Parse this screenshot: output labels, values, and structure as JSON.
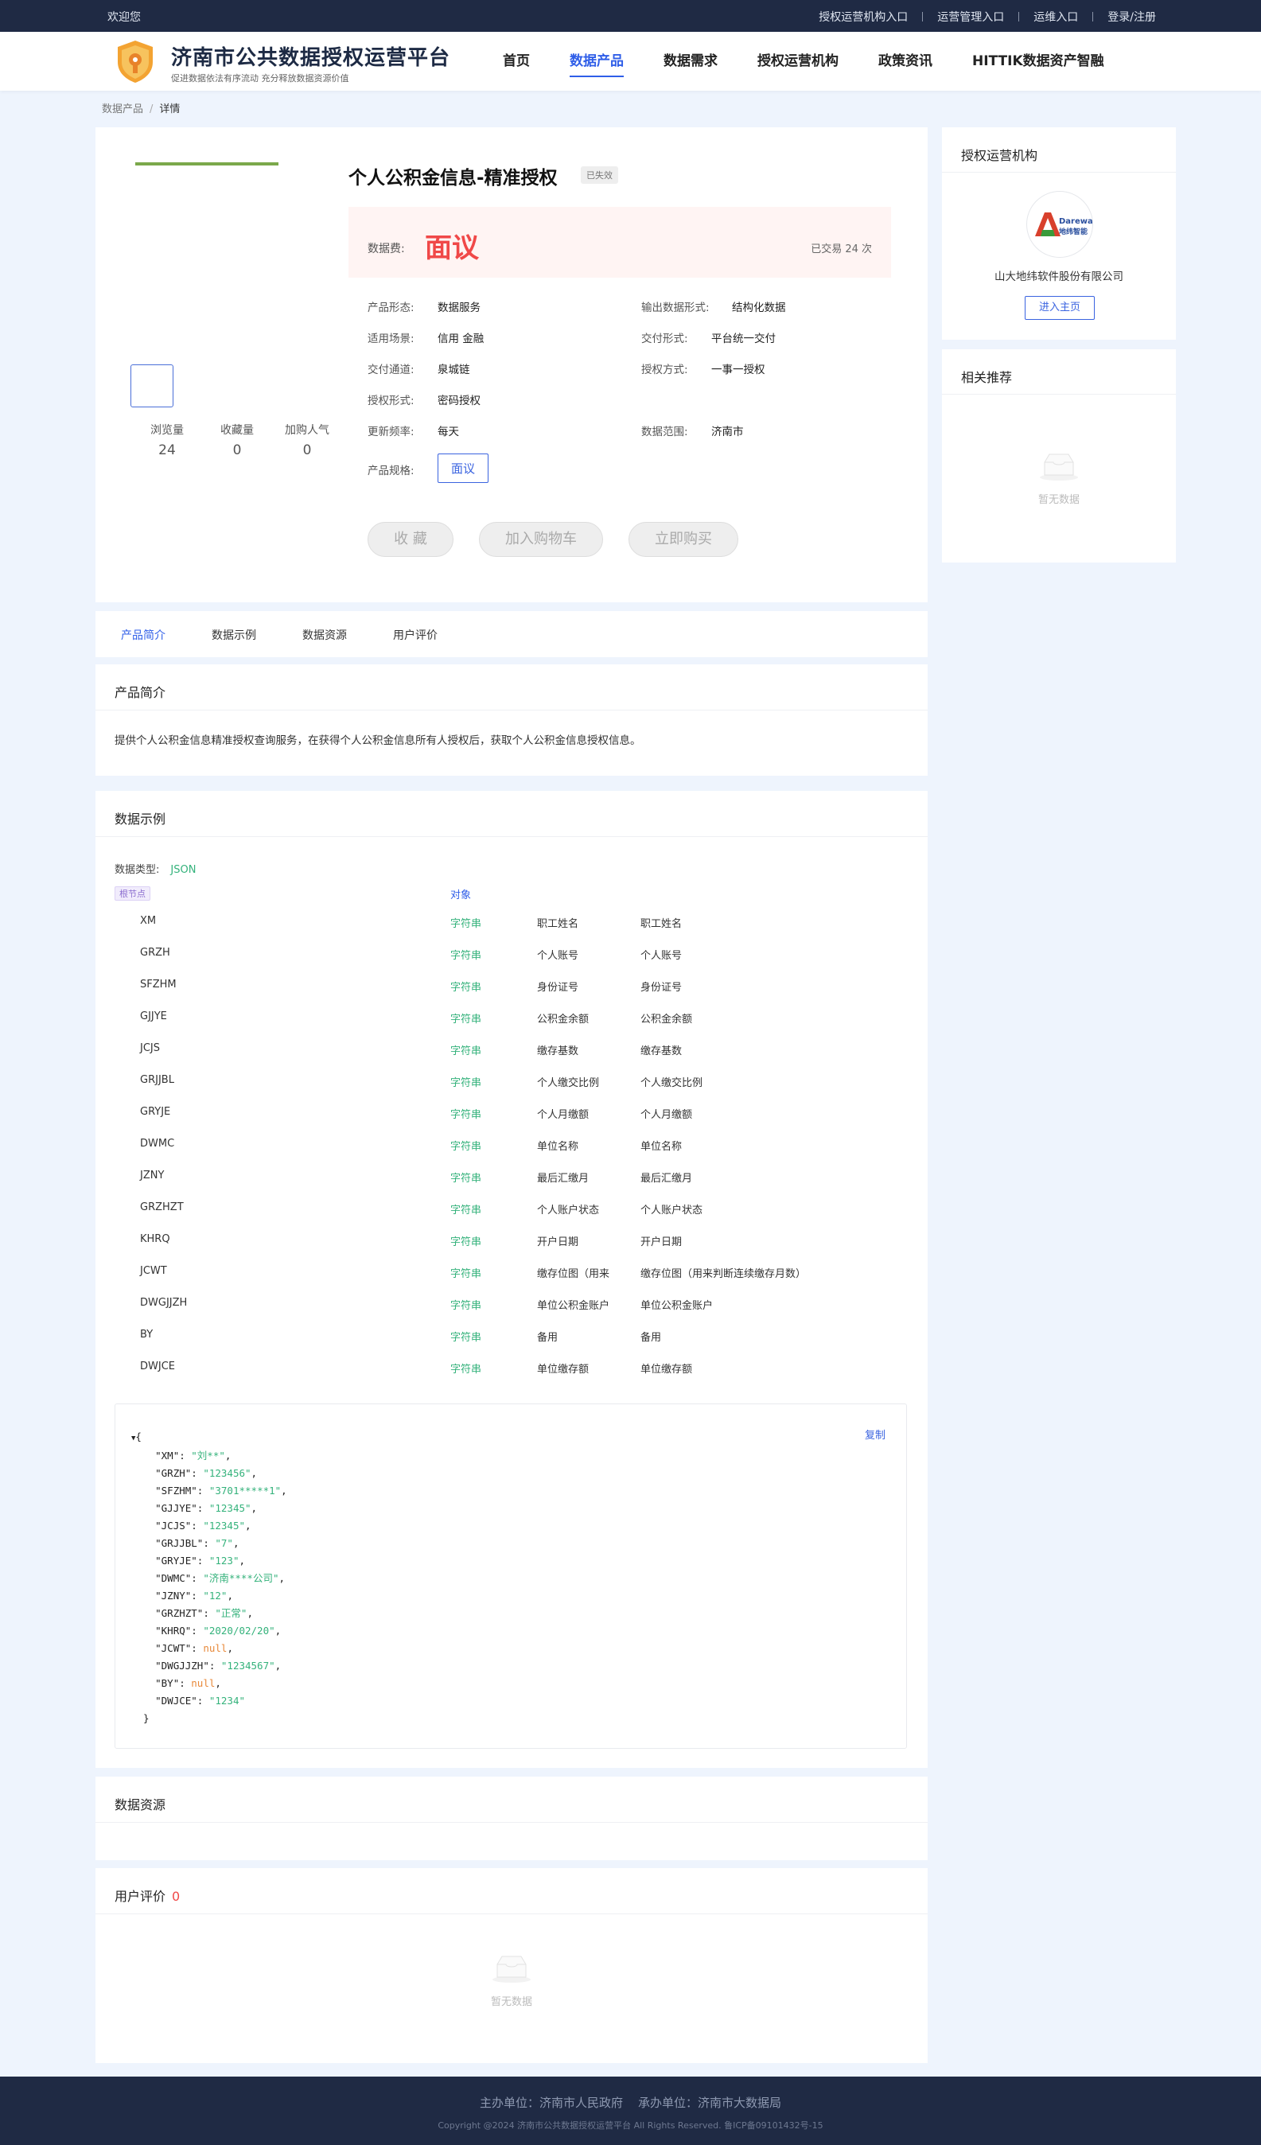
{
  "topbar": {
    "welcome": "欢迎您",
    "links": [
      "授权运营机构入口",
      "运营管理入口",
      "运维入口",
      "登录/注册"
    ]
  },
  "header": {
    "title": "济南市公共数据授权运营平台",
    "subtitle": "促进数据依法有序流动 充分释放数据资源价值",
    "nav": [
      "首页",
      "数据产品",
      "数据需求",
      "授权运营机构",
      "政策资讯",
      "HITTIK数据资产智融"
    ],
    "active_nav": "数据产品"
  },
  "breadcrumb": {
    "parent": "数据产品",
    "current": "详情"
  },
  "product": {
    "title": "个人公积金信息-精准授权",
    "status_badge": "已失效",
    "price_label": "数据费:",
    "price": "面议",
    "trade_count": "已交易 24 次",
    "stats": [
      {
        "label": "浏览量",
        "value": "24"
      },
      {
        "label": "收藏量",
        "value": "0"
      },
      {
        "label": "加购人气",
        "value": "0"
      }
    ],
    "attrs": {
      "form_label": "产品形态:",
      "form": "数据服务",
      "output_label": "输出数据形式:",
      "output": "结构化数据",
      "scene_label": "适用场景:",
      "scene": "信用  金融",
      "delivery_label": "交付形式:",
      "delivery": "平台统一交付",
      "channel_label": "交付通道:",
      "channel": "泉城链",
      "auth_mode_label": "授权方式:",
      "auth_mode": "一事一授权",
      "auth_form_label": "授权形式:",
      "auth_form": "密码授权",
      "freq_label": "更新频率:",
      "freq": "每天",
      "range_label": "数据范围:",
      "range": "济南市",
      "spec_label": "产品规格:",
      "spec": "面议"
    },
    "actions": [
      "收 藏",
      "加入购物车",
      "立即购买"
    ]
  },
  "tabs": [
    "产品简介",
    "数据示例",
    "数据资源",
    "用户评价"
  ],
  "intro": {
    "title": "产品简介",
    "text": "提供个人公积金信息精准授权查询服务，在获得个人公积金信息所有人授权后，获取个人公积金信息授权信息。"
  },
  "sample": {
    "title": "数据示例",
    "type_label": "数据类型:",
    "type_value": "JSON",
    "root_tag": "根节点",
    "root_type": "对象",
    "fields": [
      {
        "name": "XM",
        "type": "字符串",
        "d1": "职工姓名",
        "d2": "职工姓名"
      },
      {
        "name": "GRZH",
        "type": "字符串",
        "d1": "个人账号",
        "d2": "个人账号"
      },
      {
        "name": "SFZHM",
        "type": "字符串",
        "d1": "身份证号",
        "d2": "身份证号"
      },
      {
        "name": "GJJYE",
        "type": "字符串",
        "d1": "公积金余额",
        "d2": "公积金余额"
      },
      {
        "name": "JCJS",
        "type": "字符串",
        "d1": "缴存基数",
        "d2": "缴存基数"
      },
      {
        "name": "GRJJBL",
        "type": "字符串",
        "d1": "个人缴交比例",
        "d2": "个人缴交比例"
      },
      {
        "name": "GRYJE",
        "type": "字符串",
        "d1": "个人月缴额",
        "d2": "个人月缴额"
      },
      {
        "name": "DWMC",
        "type": "字符串",
        "d1": "单位名称",
        "d2": "单位名称"
      },
      {
        "name": "JZNY",
        "type": "字符串",
        "d1": "最后汇缴月",
        "d2": "最后汇缴月"
      },
      {
        "name": "GRZHZT",
        "type": "字符串",
        "d1": "个人账户状态",
        "d2": "个人账户状态"
      },
      {
        "name": "KHRQ",
        "type": "字符串",
        "d1": "开户日期",
        "d2": "开户日期"
      },
      {
        "name": "JCWT",
        "type": "字符串",
        "d1": "缴存位图（用来",
        "d2": "缴存位图（用来判断连续缴存月数）"
      },
      {
        "name": "DWGJJZH",
        "type": "字符串",
        "d1": "单位公积金账户",
        "d2": "单位公积金账户"
      },
      {
        "name": "BY",
        "type": "字符串",
        "d1": "备用",
        "d2": "备用"
      },
      {
        "name": "DWJCE",
        "type": "字符串",
        "d1": "单位缴存额",
        "d2": "单位缴存额"
      }
    ],
    "copy_label": "复制",
    "json_lines": [
      {
        "k": "XM",
        "v": "\"刘**\"",
        "t": "s"
      },
      {
        "k": "GRZH",
        "v": "\"123456\"",
        "t": "s"
      },
      {
        "k": "SFZHM",
        "v": "\"3701*****1\"",
        "t": "s"
      },
      {
        "k": "GJJYE",
        "v": "\"12345\"",
        "t": "s"
      },
      {
        "k": "JCJS",
        "v": "\"12345\"",
        "t": "s"
      },
      {
        "k": "GRJJBL",
        "v": "\"7\"",
        "t": "s"
      },
      {
        "k": "GRYJE",
        "v": "\"123\"",
        "t": "s"
      },
      {
        "k": "DWMC",
        "v": "\"济南****公司\"",
        "t": "s"
      },
      {
        "k": "JZNY",
        "v": "\"12\"",
        "t": "s"
      },
      {
        "k": "GRZHZT",
        "v": "\"正常\"",
        "t": "s"
      },
      {
        "k": "KHRQ",
        "v": "\"2020/02/20\"",
        "t": "s"
      },
      {
        "k": "JCWT",
        "v": "null",
        "t": "n"
      },
      {
        "k": "DWGJJZH",
        "v": "\"1234567\"",
        "t": "s"
      },
      {
        "k": "BY",
        "v": "null",
        "t": "n"
      },
      {
        "k": "DWJCE",
        "v": "\"1234\"",
        "t": "s"
      }
    ]
  },
  "resources": {
    "title": "数据资源"
  },
  "reviews": {
    "title": "用户评价",
    "count": "0",
    "empty_text": "暂无数据"
  },
  "sidebar": {
    "org_title": "授权运营机构",
    "org_logo_text": "Dareway",
    "org_logo_sub": "地纬智能",
    "org_name": "山大地纬软件股份有限公司",
    "enter_button": "进入主页",
    "rec_title": "相关推荐",
    "rec_empty": "暂无数据"
  },
  "footer": {
    "sponsors": "主办单位：济南市人民政府    承办单位：济南市大数据局",
    "copyright": "Copyright @2024 济南市公共数据授权运营平台 All Rights Reserved. 鲁ICP备09101432号-15"
  }
}
